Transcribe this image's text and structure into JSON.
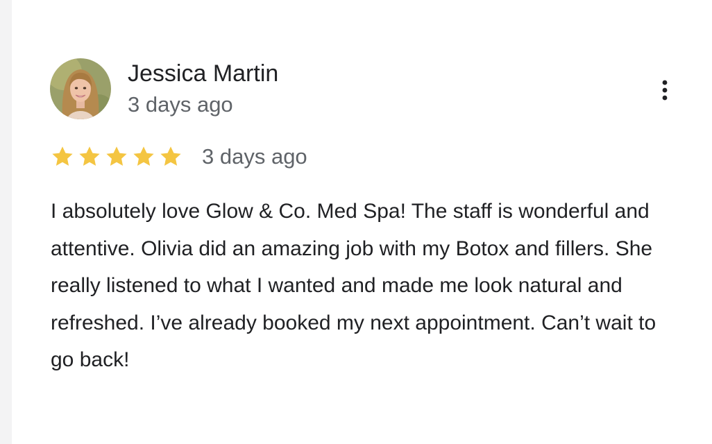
{
  "review": {
    "author_name": "Jessica Martin",
    "author_time": "3 days ago",
    "avatar": "user-avatar-photo",
    "more_icon": "more-vert-icon",
    "rating": 5,
    "rating_max": 5,
    "star_color": "#f4c542",
    "rating_time": "3 days ago",
    "text": "I absolutely love Glow & Co. Med Spa! The staff is wonderful and attentive. Olivia did an amazing job with my Botox and fillers. She really listened to what I wanted and made me look natural and refreshed. I’ve already booked my next appointment. Can’t wait to go back!"
  }
}
